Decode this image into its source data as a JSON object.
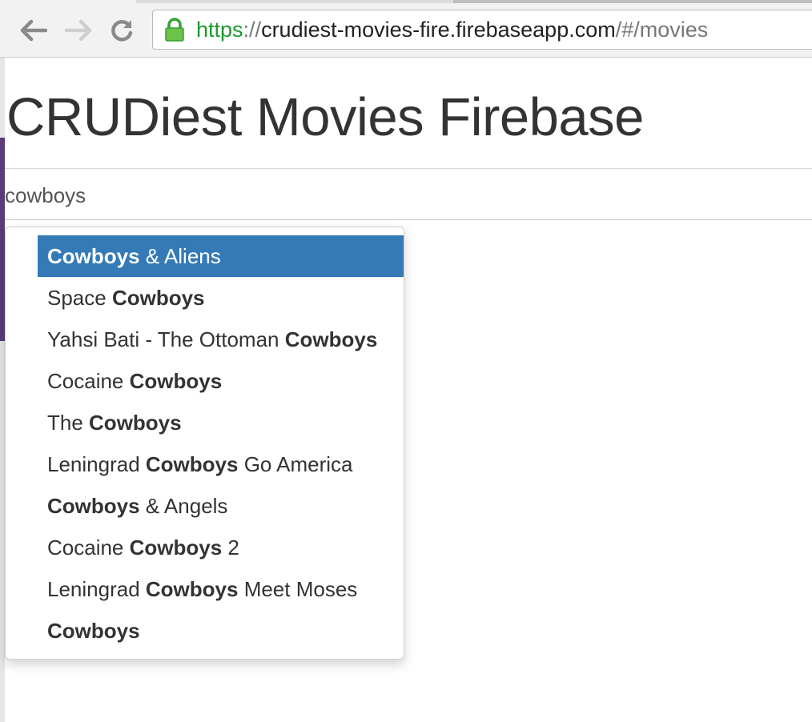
{
  "browser": {
    "url_scheme": "https",
    "url_separator": "://",
    "url_host": "crudiest-movies-fire.firebaseapp.com",
    "url_path": "/#/movies"
  },
  "page": {
    "title": "CRUDiest Movies Firebase"
  },
  "search": {
    "value": "cowboys"
  },
  "autocomplete": {
    "active_index": 0,
    "items": [
      {
        "before": "",
        "match": "Cowboys",
        "after": " & Aliens"
      },
      {
        "before": "Space ",
        "match": "Cowboys",
        "after": ""
      },
      {
        "before": "Yahsi Bati - The Ottoman ",
        "match": "Cowboys",
        "after": ""
      },
      {
        "before": "Cocaine ",
        "match": "Cowboys",
        "after": ""
      },
      {
        "before": "The ",
        "match": "Cowboys",
        "after": ""
      },
      {
        "before": "Leningrad ",
        "match": "Cowboys",
        "after": " Go America"
      },
      {
        "before": "",
        "match": "Cowboys",
        "after": " & Angels"
      },
      {
        "before": "Cocaine ",
        "match": "Cowboys",
        "after": " 2"
      },
      {
        "before": "Leningrad ",
        "match": "Cowboys",
        "after": " Meet Moses"
      },
      {
        "before": "",
        "match": "Cowboys",
        "after": ""
      }
    ]
  },
  "colors": {
    "active_item": "#337ab7",
    "secure_scheme": "#1a9a2e"
  }
}
